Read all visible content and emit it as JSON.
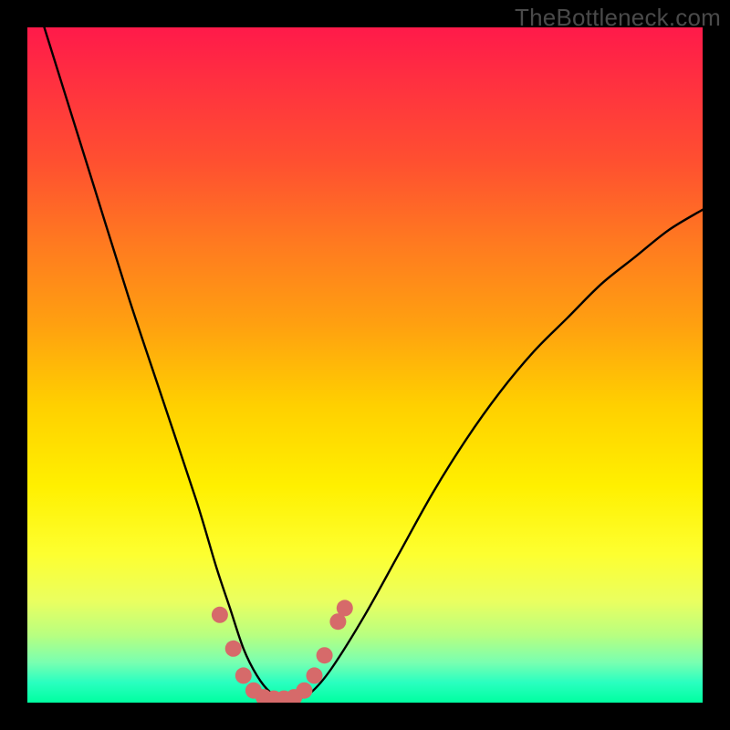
{
  "watermark": "TheBottleneck.com",
  "chart_data": {
    "type": "line",
    "title": "",
    "xlabel": "",
    "ylabel": "",
    "xlim": [
      0,
      100
    ],
    "ylim": [
      0,
      100
    ],
    "series": [
      {
        "name": "bottleneck-curve",
        "x": [
          0,
          5,
          10,
          15,
          20,
          25,
          28,
          30,
          32,
          34,
          36,
          38,
          40,
          42,
          45,
          50,
          55,
          60,
          65,
          70,
          75,
          80,
          85,
          90,
          95,
          100
        ],
        "y": [
          108,
          92,
          76,
          60,
          45,
          30,
          20,
          14,
          8,
          4,
          1.5,
          0.6,
          0.6,
          1.5,
          5,
          13,
          22,
          31,
          39,
          46,
          52,
          57,
          62,
          66,
          70,
          73
        ]
      }
    ],
    "highlights": {
      "name": "valley-dots",
      "color": "#d66a6a",
      "x": [
        28.5,
        30.5,
        32.0,
        33.5,
        35.0,
        36.5,
        38.0,
        39.5,
        41.0,
        42.5,
        44.0,
        46.0,
        47.0
      ],
      "y": [
        13.0,
        8.0,
        4.0,
        1.8,
        0.8,
        0.6,
        0.6,
        0.8,
        1.8,
        4.0,
        7.0,
        12.0,
        14.0
      ]
    },
    "gradient_stops": [
      {
        "pos": 0,
        "color": "#ff1a4a"
      },
      {
        "pos": 50,
        "color": "#ffd000"
      },
      {
        "pos": 80,
        "color": "#fdff30"
      },
      {
        "pos": 100,
        "color": "#00ffa0"
      }
    ]
  }
}
